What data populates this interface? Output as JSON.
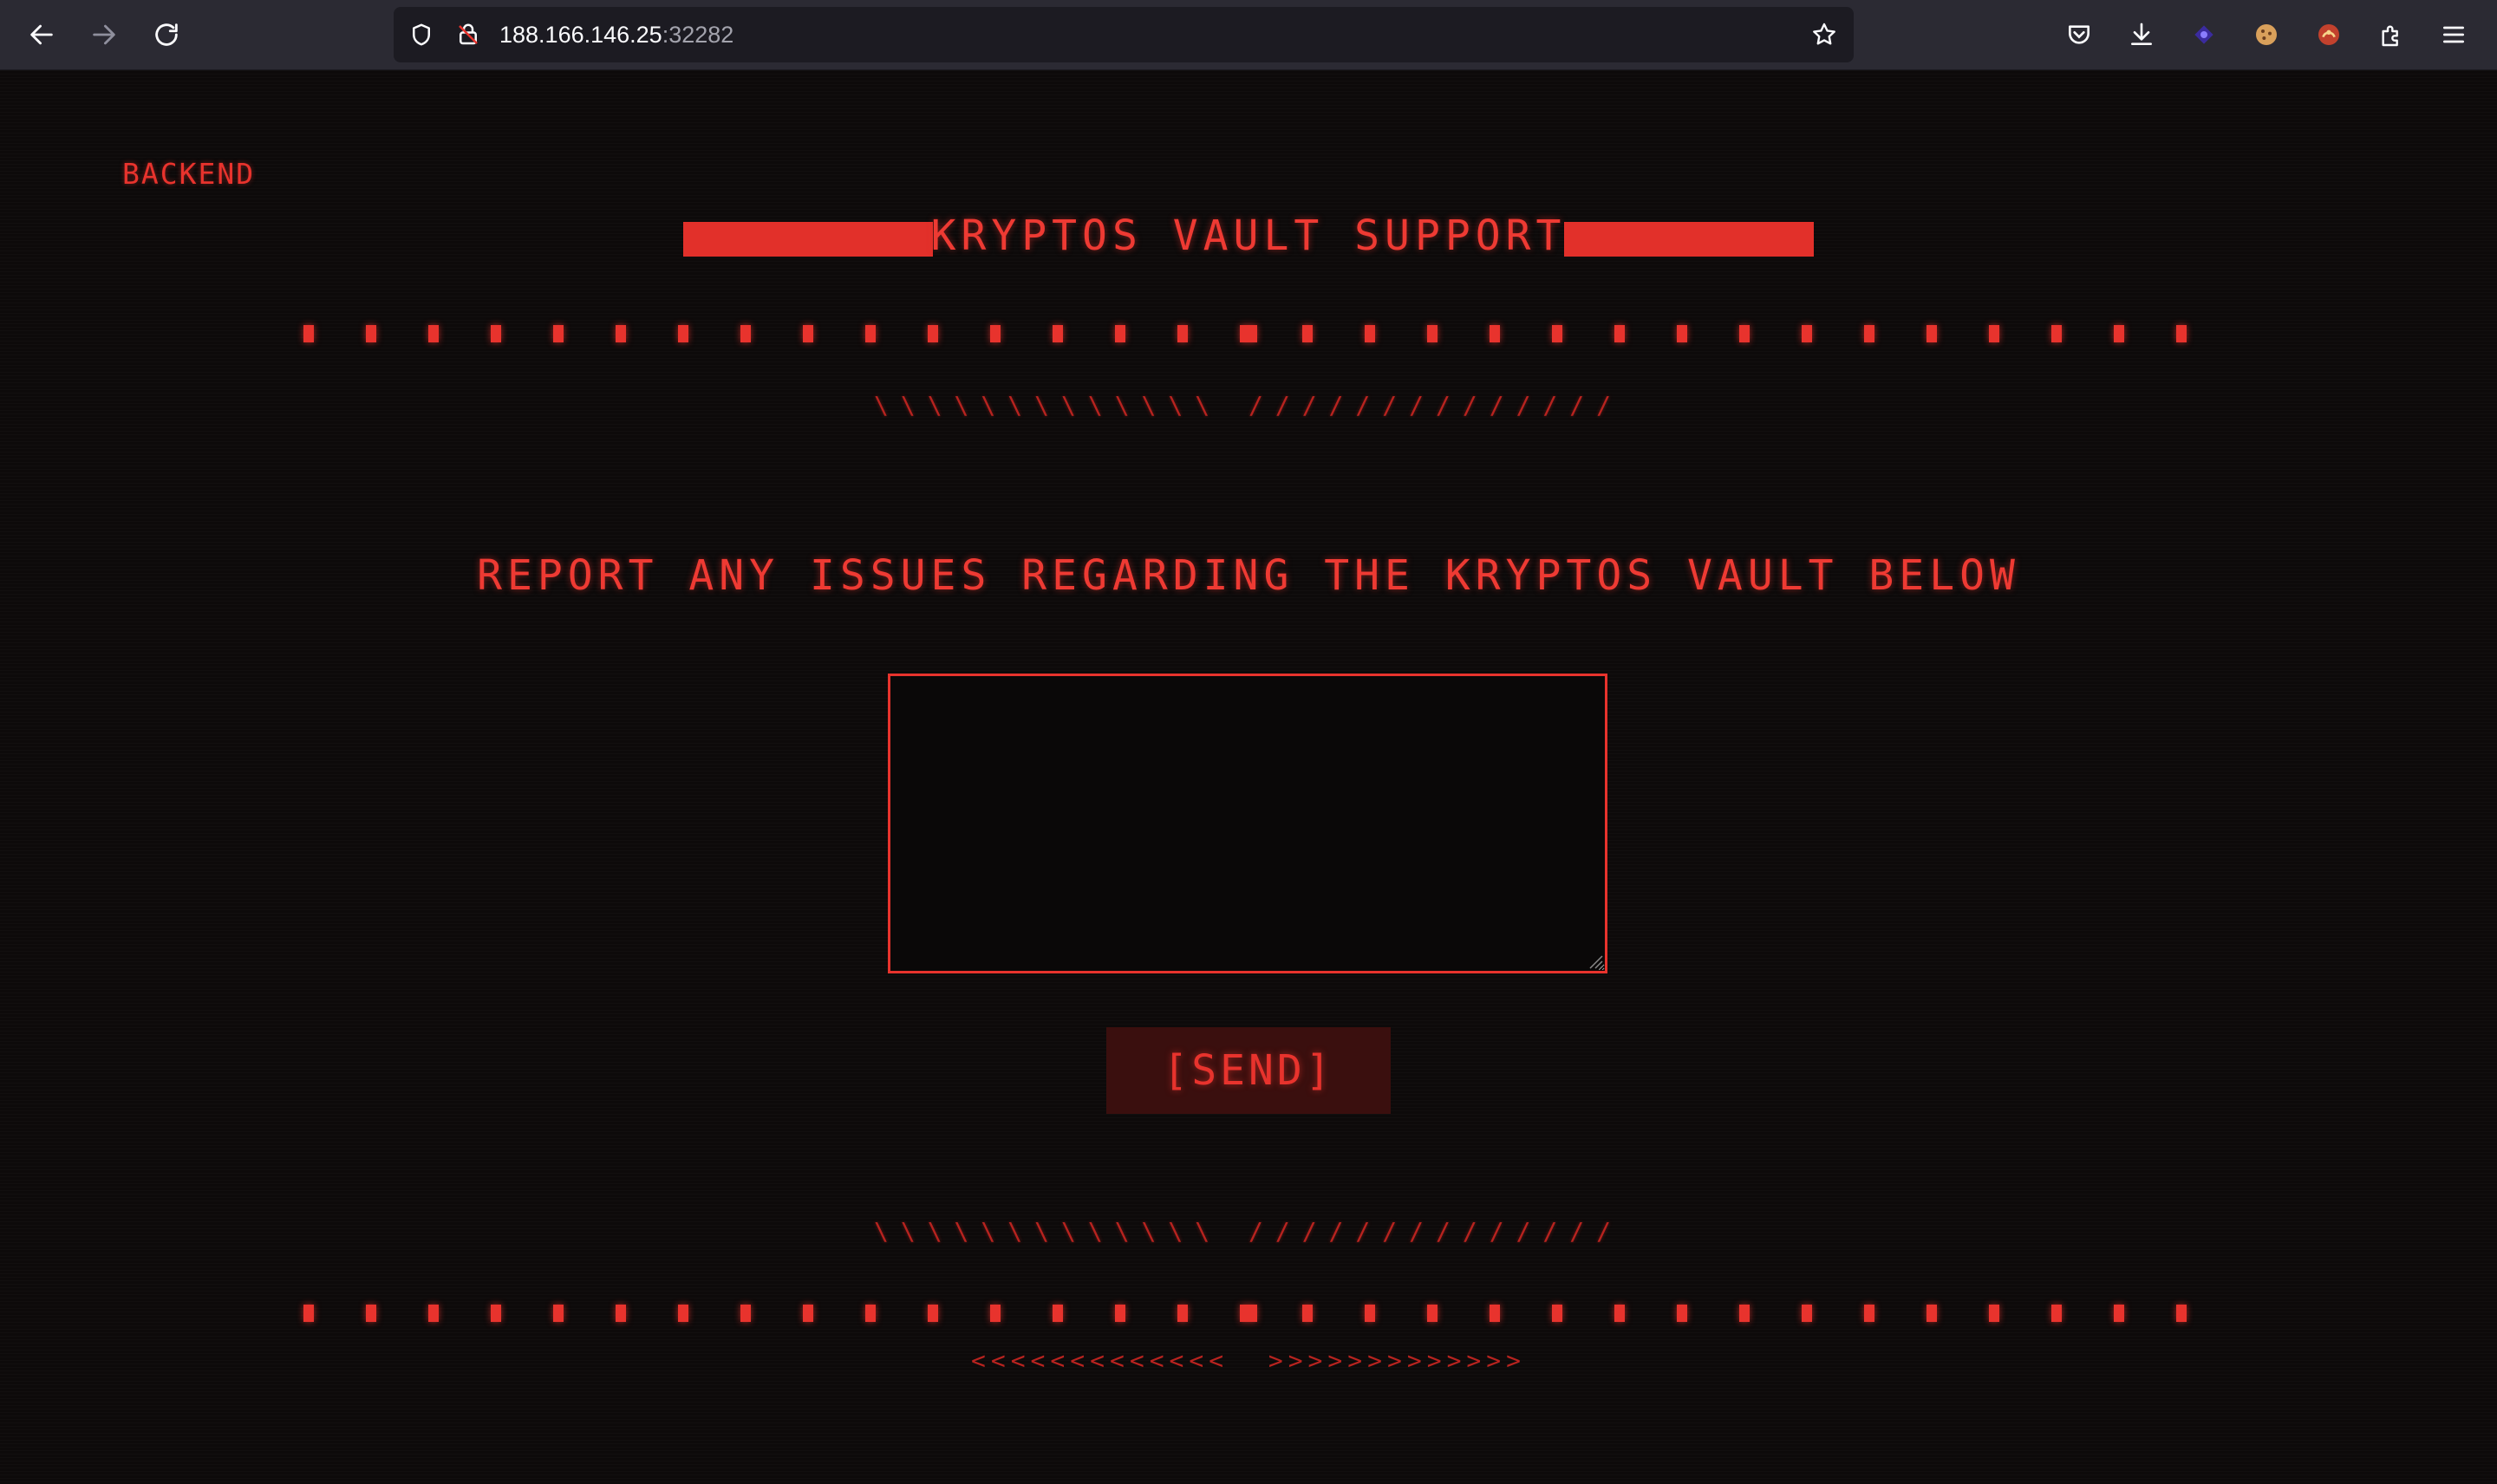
{
  "browser": {
    "url_host": "188.166.146.25",
    "url_port": ":32282",
    "icons": {
      "back": "arrow-left",
      "forward": "arrow-right",
      "reload": "reload",
      "shield": "shield",
      "insecure": "lock-strikethrough",
      "bookmark": "star",
      "pocket": "pocket",
      "downloads": "download-arrow",
      "extensions": [
        "purple-extension",
        "cookie-extension",
        "red-extension"
      ],
      "puzzle": "puzzle-piece",
      "menu": "hamburger"
    }
  },
  "page": {
    "backend_link": "BACKEND",
    "title": "KRYPTOS VAULT SUPPORT",
    "prompt": "REPORT ANY ISSUES REGARDING THE KRYPTOS VAULT BELOW",
    "textarea_value": "",
    "send_label": "[SEND]",
    "dash_pattern": "\\\\\\\\\\\\\\\\\\\\\\\\\\ //////////////",
    "arrow_pattern": "<<<<<<<<<<<<<  >>>>>>>>>>>>>"
  },
  "colors": {
    "accent": "#e8332d",
    "background": "#0d0a0a",
    "button_bg": "#3a0f0e",
    "chrome_bg": "#2b2a33"
  }
}
